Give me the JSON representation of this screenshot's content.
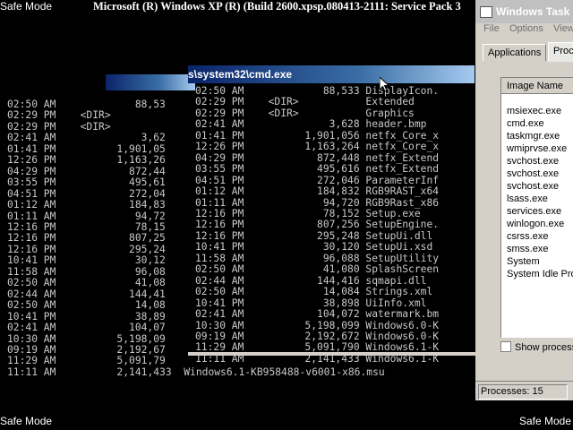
{
  "safe_mode": {
    "top_left": "Safe Mode",
    "bottom_left": "Safe Mode",
    "bottom_right": "Safe Mode"
  },
  "screen_title": "Microsoft (R) Windows XP (R) (Build 2600.xpsp.080413-2111: Service Pack 3",
  "back_listing": [
    "02:50 AM             88,53",
    "02:29 PM    <DIR>",
    "02:29 PM    <DIR>",
    "02:41 AM              3,62",
    "01:41 PM          1,901,05",
    "12:26 PM          1,163,26",
    "04:29 PM            872,44",
    "03:55 PM            495,61",
    "04:51 PM            272,04",
    "01:12 AM            184,83",
    "01:11 AM             94,72",
    "12:16 PM             78,15",
    "12:16 PM            807,25",
    "12:16 PM            295,24",
    "10:41 PM             30,12",
    "11:58 AM             96,08",
    "02:50 AM             41,08",
    "02:44 AM            144,41",
    "02:50 AM             14,08",
    "10:41 PM             38,89",
    "02:41 AM            104,07",
    "10:30 AM          5,198,09",
    "09:19 AM          2,192,67",
    "11:29 AM          5,091,79",
    "11:11 AM          2,141,433  Windows6.1-KB958488-v6001-x86.msu"
  ],
  "cmd_window": {
    "title": "s\\system32\\cmd.exe",
    "listing": [
      "02:50 AM             88,533 DisplayIcon.",
      "02:29 PM    <DIR>           Extended",
      "02:29 PM    <DIR>           Graphics",
      "02:41 AM              3,628 header.bmp",
      "01:41 PM          1,901,056 netfx_Core_x",
      "12:26 PM          1,163,264 netfx_Core_x",
      "04:29 PM            872,448 netfx_Extend",
      "03:55 PM            495,616 netfx_Extend",
      "04:51 PM            272,046 ParameterInf",
      "01:12 AM            184,832 RGB9RAST_x64",
      "01:11 AM             94,720 RGB9Rast_x86",
      "12:16 PM             78,152 Setup.exe",
      "12:16 PM            807,256 SetupEngine.",
      "12:16 PM            295,248 SetupUi.dll",
      "10:41 PM             30,120 SetupUi.xsd",
      "11:58 AM             96,088 SetupUtility",
      "02:50 AM             41,080 SplashScreen",
      "02:44 AM            144,416 sqmapi.dll",
      "02:50 AM             14,084 Strings.xml",
      "10:41 PM             38,898 UiInfo.xml",
      "02:41 AM            104,072 watermark.bm",
      "10:30 AM          5,198,099 Windows6.0-K",
      "09:19 AM          2,192,672 Windows6.0-K",
      "11:29 AM          5,091,790 Windows6.1-K",
      "11:11 AM          2,141,433 Windows6.1-K"
    ]
  },
  "task_manager": {
    "title": "Windows Task M",
    "menu": [
      "File",
      "Options",
      "View"
    ],
    "tabs": [
      "Applications",
      "Proce"
    ],
    "column_header": "Image Name",
    "processes": [
      "msiexec.exe",
      "cmd.exe",
      "taskmgr.exe",
      "wmiprvse.exe",
      "svchost.exe",
      "svchost.exe",
      "svchost.exe",
      "lsass.exe",
      "services.exe",
      "winlogon.exe",
      "csrss.exe",
      "smss.exe",
      "System",
      "System Idle Pro"
    ],
    "show_processes_label": "Show process",
    "status_processes": "Processes: 15"
  }
}
